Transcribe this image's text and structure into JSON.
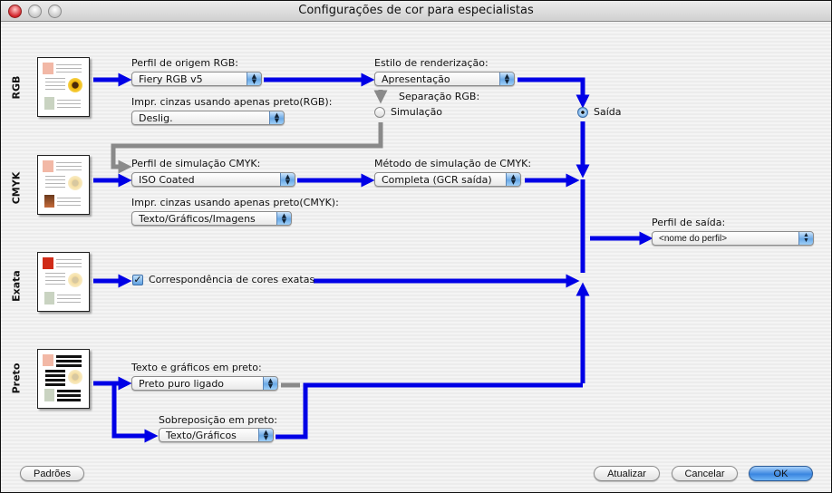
{
  "window": {
    "title": "Configurações de cor para especialistas",
    "controls": [
      "close",
      "minimize",
      "zoom"
    ]
  },
  "colors": {
    "flow_active": "#0000e6",
    "flow_inactive": "#8a8a8a",
    "default_button": "#3a86e0"
  },
  "sections": {
    "rgb": {
      "label": "RGB",
      "source_profile": {
        "label": "Perfil de origem RGB:",
        "value": "Fiery RGB v5"
      },
      "gray_black": {
        "label": "Impr. cinzas usando apenas preto(RGB):",
        "value": "Deslig."
      },
      "rendering_style": {
        "label": "Estilo de renderização:",
        "value": "Apresentação"
      },
      "separation": {
        "label": "Separação RGB:",
        "options": [
          {
            "label": "Simulação",
            "selected": false
          },
          {
            "label": "Saída",
            "selected": true
          }
        ]
      }
    },
    "cmyk": {
      "label": "CMYK",
      "simulation_profile": {
        "label": "Perfil de simulação CMYK:",
        "value": "ISO Coated"
      },
      "gray_black": {
        "label": "Impr. cinzas usando apenas preto(CMYK):",
        "value": "Texto/Gráficos/Imagens"
      },
      "simulation_method": {
        "label": "Método de simulação de CMYK:",
        "value": "Completa (GCR saída)"
      }
    },
    "exact": {
      "label": "Exata",
      "spot_match": {
        "label": "Correspondência de cores exatas",
        "checked": true
      }
    },
    "black": {
      "label": "Preto",
      "pure_black": {
        "label": "Texto e gráficos em preto:",
        "value": "Preto puro ligado"
      },
      "overprint": {
        "label": "Sobreposição em preto:",
        "value": "Texto/Gráficos"
      }
    },
    "output": {
      "profile": {
        "label": "Perfil de saída:",
        "value": "<nome do perfil>"
      }
    }
  },
  "footer": {
    "defaults": "Padrões",
    "update": "Atualizar",
    "cancel": "Cancelar",
    "ok": "OK"
  }
}
